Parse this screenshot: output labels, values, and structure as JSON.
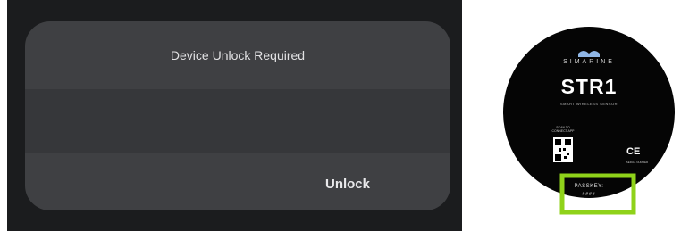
{
  "dialog": {
    "title": "Device Unlock Required",
    "input_value": "",
    "unlock_label": "Unlock"
  },
  "device": {
    "brand": "SIMARINE",
    "model": "STR1",
    "tagline": "SMART WIRELESS SENSOR",
    "qr_caption_line1": "SCAN TO",
    "qr_caption_line2": "CONNECT APP",
    "compliance_mark": "CE",
    "compliance_caption": "SERIAL NUMBER",
    "passkey_label": "PASSKEY:",
    "passkey_value": "####",
    "highlight_color": "#8fd21a",
    "logo_color": "#8fb6e6"
  }
}
